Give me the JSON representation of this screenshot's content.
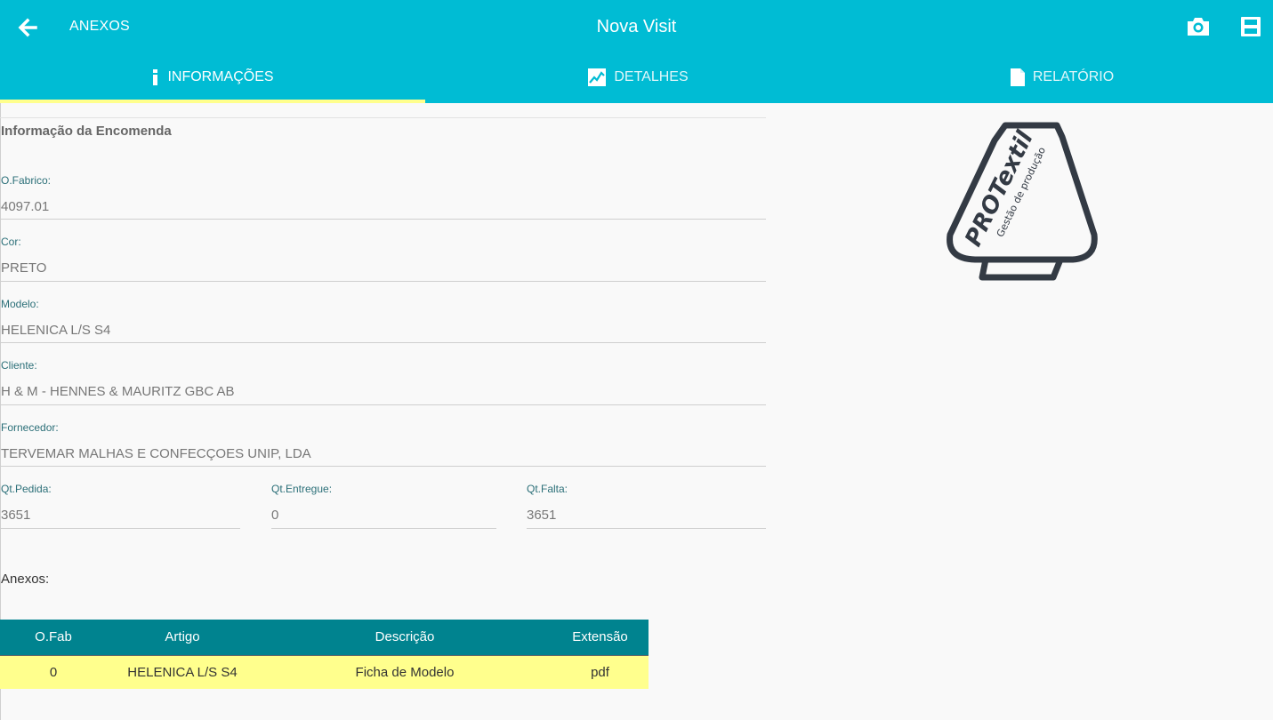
{
  "header": {
    "back_label": "ANEXOS",
    "title": "Nova Visit",
    "back_icon": "arrow-left-icon",
    "actions": [
      "camera-icon",
      "save-icon"
    ]
  },
  "tabs": [
    {
      "label": "INFORMAÇÕES",
      "icon": "info-icon",
      "active": true
    },
    {
      "label": "DETALHES",
      "icon": "image-icon",
      "active": false
    },
    {
      "label": "RELATÓRIO",
      "icon": "document-icon",
      "active": false
    }
  ],
  "form": {
    "section_title": "Informação da Encomenda",
    "ofabrico": {
      "label": "O.Fabrico:",
      "value": "4097.01"
    },
    "cor": {
      "label": "Cor:",
      "value": "PRETO"
    },
    "modelo": {
      "label": "Modelo:",
      "value": "HELENICA L/S S4"
    },
    "cliente": {
      "label": "Cliente:",
      "value": "H & M - HENNES & MAURITZ GBC AB"
    },
    "fornecedor": {
      "label": "Fornecedor:",
      "value": "TERVEMAR MALHAS E CONFECÇOES UNIP, LDA"
    },
    "qt_pedida": {
      "label": "Qt.Pedida:",
      "value": "3651"
    },
    "qt_entregue": {
      "label": "Qt.Entregue:",
      "value": "0"
    },
    "qt_falta": {
      "label": "Qt.Falta:",
      "value": "3651"
    }
  },
  "anexos": {
    "title": "Anexos:",
    "columns": [
      "O.Fab",
      "Artigo",
      "Descrição",
      "Extensão"
    ],
    "rows": [
      [
        "0",
        "HELENICA L/S S4",
        "Ficha de Modelo",
        "pdf"
      ]
    ]
  },
  "logo": {
    "brand": "PROTextil",
    "tagline": "Gestão de produção"
  },
  "colors": {
    "primary": "#00bcd4",
    "tab_indicator": "#ffff8d",
    "table_header": "#00838f",
    "table_row": "#ffff8d",
    "label": "#2b6f78"
  }
}
